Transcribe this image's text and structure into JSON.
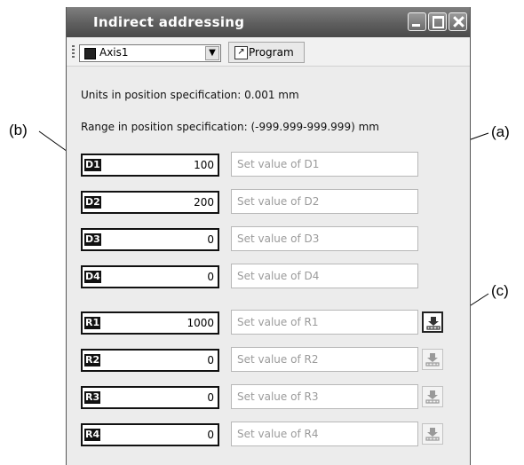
{
  "callouts": {
    "b": "(b)",
    "a": "(a)",
    "c": "(c)"
  },
  "window": {
    "title": "Indirect addressing",
    "axis": "Axis1",
    "program_label": "Program",
    "units_text": "Units in position specification: 0.001 mm",
    "range_text": "Range in position specification: (-999.999-999.999) mm"
  },
  "rows": [
    {
      "label": "D1",
      "value": "100",
      "placeholder": "Set value of D1",
      "has_button": false
    },
    {
      "label": "D2",
      "value": "200",
      "placeholder": "Set value of D2",
      "has_button": false
    },
    {
      "label": "D3",
      "value": "0",
      "placeholder": "Set value of D3",
      "has_button": false
    },
    {
      "label": "D4",
      "value": "0",
      "placeholder": "Set value of D4",
      "has_button": false
    },
    {
      "label": "R1",
      "value": "1000",
      "placeholder": "Set value of R1",
      "has_button": true,
      "button_active": true
    },
    {
      "label": "R2",
      "value": "0",
      "placeholder": "Set value of R2",
      "has_button": true,
      "button_active": false
    },
    {
      "label": "R3",
      "value": "0",
      "placeholder": "Set value of R3",
      "has_button": true,
      "button_active": false
    },
    {
      "label": "R4",
      "value": "0",
      "placeholder": "Set value of R4",
      "has_button": true,
      "button_active": false
    }
  ],
  "icons": {
    "set_button": "download-arrow-icon",
    "program": "program-icon",
    "axis": "square-icon"
  },
  "colors": {
    "titlebar": "#5e5e5e",
    "label_bg": "#111111",
    "placeholder": "#9b9b9b"
  }
}
